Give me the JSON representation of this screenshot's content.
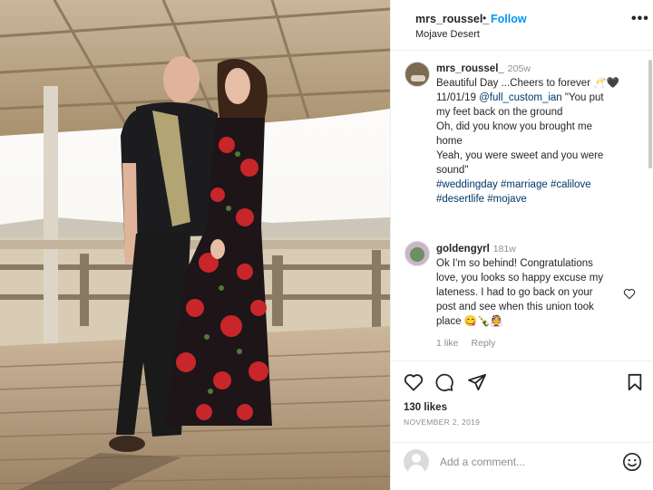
{
  "post": {
    "username": "mrs_roussel_",
    "separator": "•",
    "follow_label": "Follow",
    "location": "Mojave Desert",
    "more_label": "•••"
  },
  "caption": {
    "username": "mrs_roussel_",
    "time": "205w",
    "line1": "Beautiful Day ...Cheers to forever 🥂🖤",
    "line2_date": "11/01/19",
    "line2_mention": "@full_custom_ian",
    "line2_rest": "\"You put",
    "line3": "my feet back on the ground",
    "line4": "Oh, did you know you brought me",
    "line5": "home",
    "line6": "Yeah, you were sweet and you were",
    "line7": "sound\"",
    "hashtags_line1": "#weddingday #marriage #calilove",
    "hashtags_line2": "#desertlife #mojave"
  },
  "comment": {
    "username": "goldengyrl",
    "time": "181w",
    "line1_rest": "",
    "line1": "Ok I'm so behind! Congratulations",
    "line2": "love, you looks so happy excuse my",
    "line3": "lateness. I had to go back on your",
    "line4": "post and see when this union took",
    "line5": "place 😋🍾👰",
    "likes": "1 like",
    "reply": "Reply"
  },
  "footer": {
    "likes": "130 likes",
    "date": "NOVEMBER 2, 2019",
    "comment_placeholder": "Add a comment..."
  },
  "icons": {
    "like": "heart-icon",
    "comment": "speech-bubble-icon",
    "share": "paper-plane-icon",
    "save": "bookmark-icon",
    "emoji": "smiley-icon",
    "more": "more-options-icon"
  },
  "colors": {
    "follow_blue": "#0095f6",
    "link_navy": "#00376b",
    "muted": "#8e8e8e",
    "text": "#262626"
  }
}
